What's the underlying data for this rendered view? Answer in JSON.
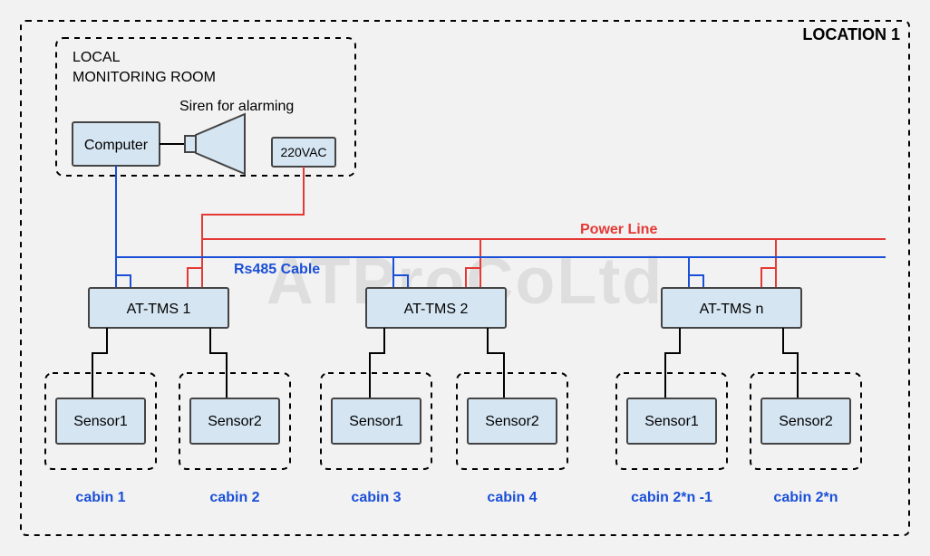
{
  "title": "LOCATION 1",
  "room": {
    "line1": "LOCAL",
    "line2": "MONITORING ROOM"
  },
  "computer_label": "Computer",
  "siren_label": "Siren for alarming",
  "power_source_label": "220VAC",
  "rs485_label": "Rs485 Cable",
  "power_line_label": "Power Line",
  "units": {
    "u1": "AT-TMS 1",
    "u2": "AT-TMS 2",
    "u3": "AT-TMS n"
  },
  "sensors": {
    "s1": "Sensor1",
    "s2": "Sensor2"
  },
  "cabins": {
    "c1": "cabin 1",
    "c2": "cabin 2",
    "c3": "cabin 3",
    "c4": "cabin 4",
    "c5": "cabin 2*n -1",
    "c6": "cabin 2*n"
  },
  "watermark": "ATProCoLtd"
}
